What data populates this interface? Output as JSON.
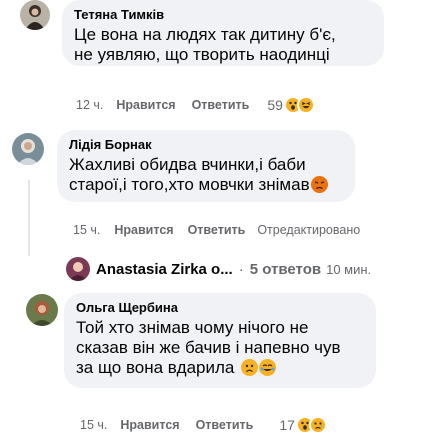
{
  "comments": [
    {
      "author": "Тетяна Тимків",
      "text_lines": [
        "Це вона на людях так дитину б'є,",
        "не уявляю, що творить наодинці"
      ],
      "time": "12 ч.",
      "like_label": "Нравится",
      "reply_label": "Ответить",
      "reaction_count": "59",
      "reactions": [
        "wow",
        "haha"
      ]
    },
    {
      "author": "Лідія Борнак",
      "text_lines": [
        "Жахливі обидва вчинки,і баби",
        "старої,і того,хто мовчки знімав"
      ],
      "time": "15 ч.",
      "like_label": "Нравится",
      "reply_label": "Ответить",
      "edited_label": "Отредактировано",
      "trailing_emoji": "angry"
    },
    {
      "author": "Ольга Щербина",
      "text_lines": [
        "Той хто знімав чому нічого не",
        "сказав він же бачив і напевно чув",
        "за що вона вдарила"
      ],
      "time": "15 ч.",
      "like_label": "Нравится",
      "reply_label": "Ответить",
      "reaction_count": "17",
      "reactions": [
        "wow",
        "sad"
      ],
      "trailing_emojis": [
        "sad",
        "tear"
      ]
    }
  ],
  "reply_summary": {
    "name": "Anastasia Zirka о...",
    "separator": "·",
    "replies": "5 ответов",
    "time": "10 мин."
  },
  "colors": {
    "bubble": "#f0f2f5",
    "meta_text": "#65676b",
    "wow": "#f7b125",
    "angry": "#e9710f"
  }
}
